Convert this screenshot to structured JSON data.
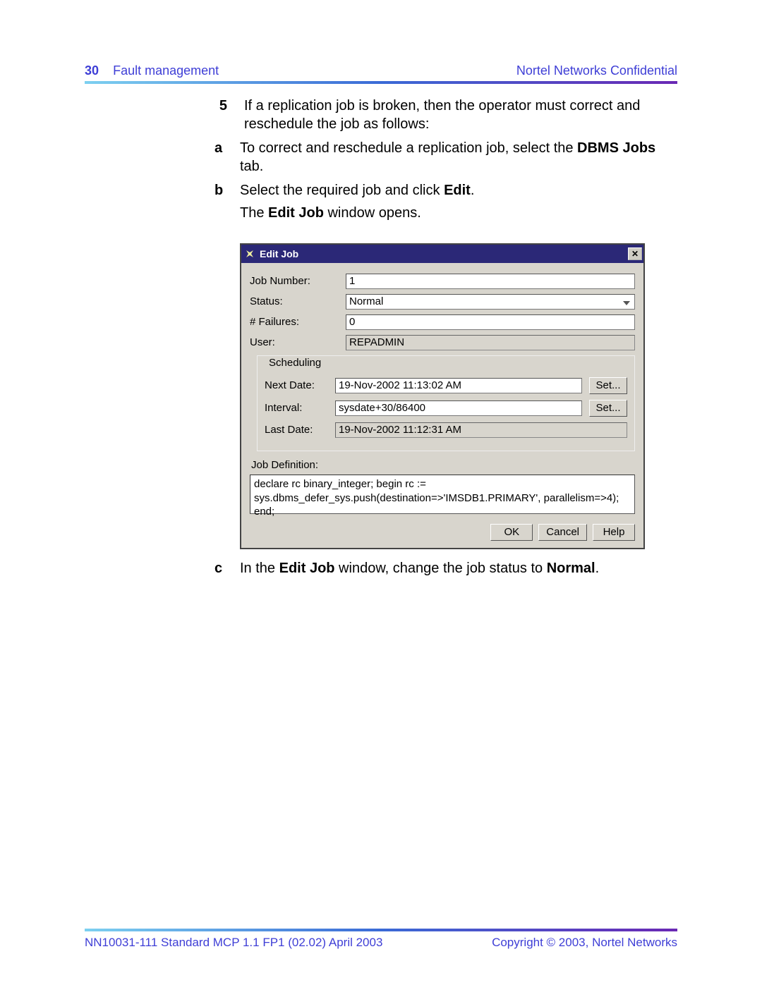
{
  "header": {
    "page_number": "30",
    "section": "Fault management",
    "confidential": "Nortel Networks Confidential"
  },
  "step5": {
    "num": "5",
    "text": "If a replication job is broken, then the operator must correct and reschedule the job as follows:",
    "a_letter": "a",
    "a_text_1": "To correct and reschedule a replication job, select the ",
    "a_bold": "DBMS Jobs",
    "a_text_2": " tab.",
    "b_letter": "b",
    "b_text_1": "Select the required job and click ",
    "b_bold": "Edit",
    "b_text_2": ".",
    "b_after_1": "The ",
    "b_after_bold": "Edit Job",
    "b_after_2": " window opens.",
    "c_letter": "c",
    "c_text_1": "In the ",
    "c_bold1": "Edit Job",
    "c_text_2": " window, change the job status to ",
    "c_bold2": "Normal",
    "c_text_3": "."
  },
  "dialog": {
    "title": "Edit Job",
    "job_number_label": "Job Number:",
    "job_number": "1",
    "status_label": "Status:",
    "status": "Normal",
    "failures_label": "# Failures:",
    "failures": "0",
    "user_label": "User:",
    "user": "REPADMIN",
    "scheduling_legend": "Scheduling",
    "next_date_label": "Next Date:",
    "next_date": "19-Nov-2002 11:13:02 AM",
    "interval_label": "Interval:",
    "interval": "sysdate+30/86400",
    "last_date_label": "Last Date:",
    "last_date": "19-Nov-2002 11:12:31 AM",
    "set_btn": "Set...",
    "jobdef_label": "Job Definition:",
    "jobdef": "declare rc binary_integer; begin rc := sys.dbms_defer_sys.push(destination=>'IMSDB1.PRIMARY', parallelism=>4); end;",
    "ok": "OK",
    "cancel": "Cancel",
    "help": "Help"
  },
  "footer": {
    "left": "NN10031-111   Standard   MCP 1.1 FP1 (02.02)   April 2003",
    "right": "Copyright © 2003, Nortel Networks"
  }
}
